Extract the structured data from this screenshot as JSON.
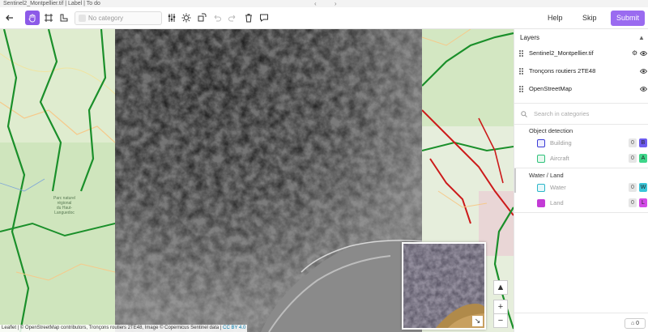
{
  "window": {
    "title": "Sentinel2_Montpellier.tif | Label | To do",
    "nav_arrows": "‹ ›"
  },
  "toolbar": {
    "category_placeholder": "No category",
    "help_label": "Help",
    "skip_label": "Skip",
    "submit_label": "Submit",
    "accent_color": "#8c5ae8"
  },
  "map": {
    "park_label": [
      "Parc naturel",
      "régional",
      "du Haut-",
      "Languedoc"
    ],
    "attribution_text": "Leaflet | © OpenStreetMap contributors, Tronçons routiers 2TE48, Image © Copernicus Sentinel data | ",
    "attribution_license": "CC BY 4.0",
    "zoom_in": "+",
    "zoom_out": "−",
    "compass": "▲",
    "minimap_toggle": "↘"
  },
  "panel": {
    "layers_title": "Layers",
    "layers": [
      {
        "name": "Sentinel2_Montpellier.tif",
        "has_settings": true
      },
      {
        "name": "Tronçons routiers 2TE48",
        "has_settings": false
      },
      {
        "name": "OpenStreetMap",
        "has_settings": false
      }
    ],
    "search_placeholder": "Search in categories",
    "groups": [
      {
        "title": "Object detection",
        "categories": [
          {
            "name": "Building",
            "count": "0",
            "key": "B",
            "color": "#3b3bd6",
            "key_bg": "#6e5cf0"
          },
          {
            "name": "Aircraft",
            "count": "0",
            "key": "A",
            "color": "#2ec27a",
            "key_bg": "#3ed68a"
          }
        ]
      },
      {
        "title": "Water / Land",
        "categories": [
          {
            "name": "Water",
            "count": "0",
            "key": "W",
            "color": "#2bb6c9",
            "key_bg": "#39c6d9"
          },
          {
            "name": "Land",
            "count": "0",
            "key": "L",
            "color": "#c33bd6",
            "key_bg": "#d24ae6"
          }
        ]
      }
    ],
    "footer_count": "0"
  }
}
